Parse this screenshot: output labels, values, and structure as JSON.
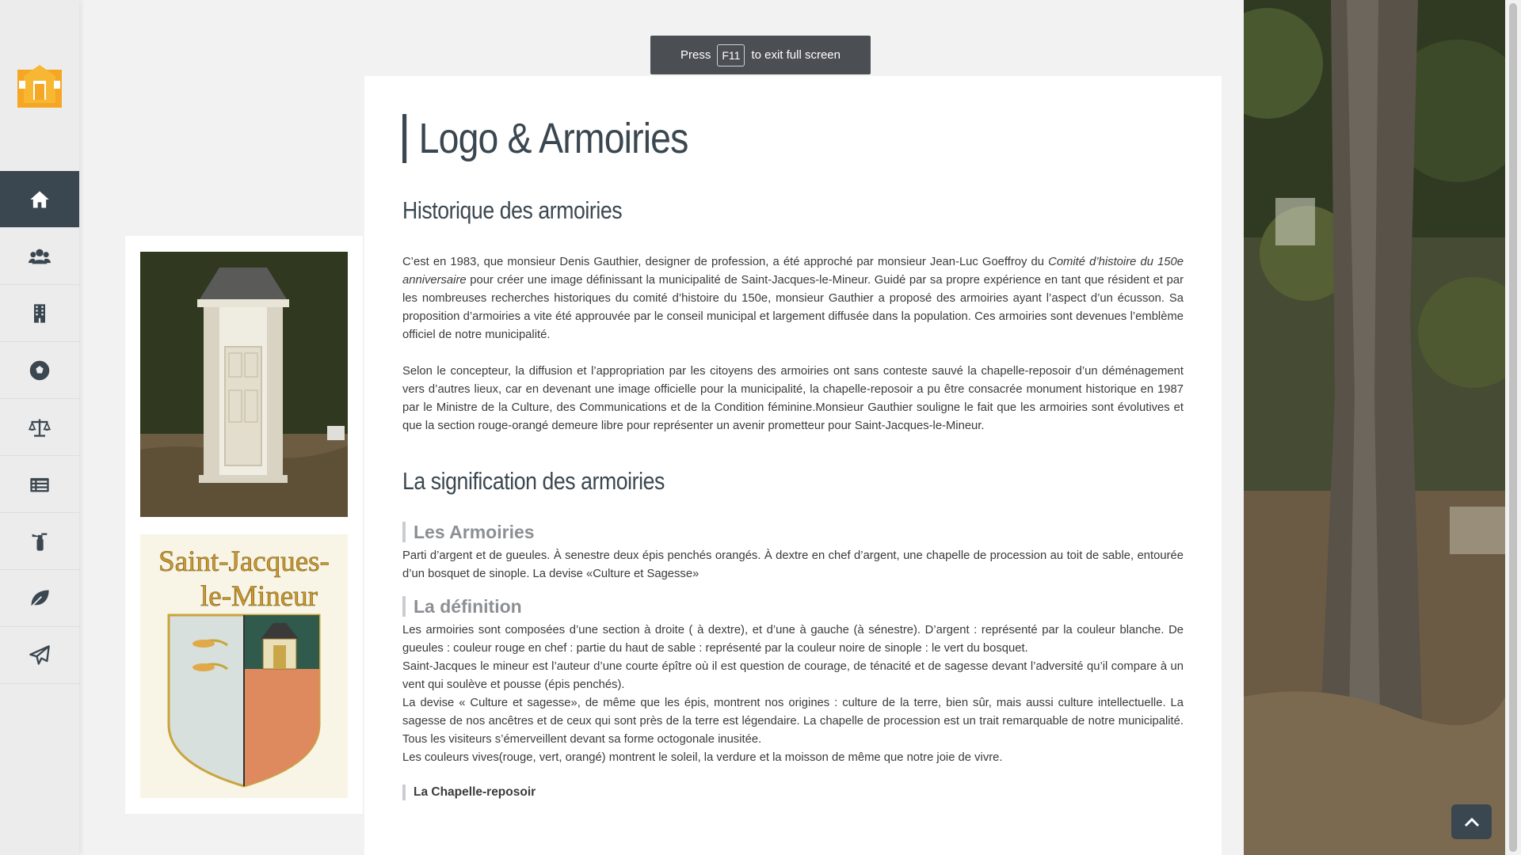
{
  "toast": {
    "press": "Press",
    "key": "F11",
    "rest": "to exit full screen"
  },
  "nav": {
    "logo_icon": "municipal-house-logo",
    "items": [
      {
        "icon": "home-icon",
        "active": true
      },
      {
        "icon": "users-icon",
        "active": false
      },
      {
        "icon": "building-icon",
        "active": false
      },
      {
        "icon": "soccer-ball-icon",
        "active": false
      },
      {
        "icon": "balance-scale-icon",
        "active": false
      },
      {
        "icon": "list-icon",
        "active": false
      },
      {
        "icon": "fire-extinguisher-icon",
        "active": false
      },
      {
        "icon": "leaf-icon",
        "active": false
      },
      {
        "icon": "paper-plane-icon",
        "active": false
      }
    ],
    "active_color": "#3b4750"
  },
  "sidebar": {
    "crest_line1": "Saint-Jacques-",
    "crest_line2": "le-Mineur"
  },
  "main": {
    "title": "Logo & Armoiries",
    "section1": {
      "heading": "Historique des armoiries",
      "p1_a": "C’est en 1983, que monsieur Denis Gauthier, designer de profession, a été approché par monsieur Jean-Luc Goeffroy du ",
      "p1_em": "Comité d’histoire du 150e anniversaire",
      "p1_b": " pour créer une image définissant la municipalité de Saint-Jacques-le-Mineur. Guidé par sa propre expérience en tant que résident et par les nombreuses recherches historiques du comité d’histoire du 150e, monsieur Gauthier a proposé des armoiries ayant l’aspect d’un écusson. Sa proposition d’armoiries a vite été approuvée par le conseil municipal et largement diffusée dans la population. Ces armoiries sont devenues l’emblème officiel de notre municipalité.",
      "p2": "Selon le concepteur, la diffusion et l’appropriation par les citoyens des armoiries ont sans conteste sauvé la chapelle-reposoir d’un déménagement vers d’autres lieux, car en devenant une image officielle pour la municipalité, la chapelle-reposoir a pu être consacrée monument historique en 1987 par le Ministre de la Culture, des Communications et de la Condition féminine.Monsieur Gauthier souligne le fait que les armoiries sont évolutives et que la section rouge-orangé demeure libre pour représenter un avenir prometteur pour Saint-Jacques-le-Mineur."
    },
    "section2": {
      "heading": "La signification des armoiries",
      "sub1": "Les Armoiries",
      "sub1_text": "Parti d’argent et de gueules. À senestre deux épis penchés orangés. À dextre en chef d’argent, une chapelle de procession au toit de sable, entourée d’un bosquet de sinople. La devise «Culture et Sagesse»",
      "sub2": "La définition",
      "sub2_l1": "Les armoiries sont composées d’une section à droite ( à dextre), et d’une à gauche (à sénestre). D’argent : représenté par la couleur blanche. De gueules : couleur rouge en chef : partie du haut de sable : représenté par la couleur noire de sinople : le vert du bosquet.",
      "sub2_l2": "Saint-Jacques le mineur est l’auteur d’une courte épître où il est question de courage, de ténacité et de sagesse devant l’adversité qu’il compare à un vent qui soulève et pousse (épis penchés).",
      "sub2_l3": "La devise « Culture et sagesse», de même que les épis, montrent nos origines : culture de la terre, bien sûr, mais aussi culture intellectuelle. La sagesse de nos ancêtres et de ceux qui sont près de la terre est légendaire. La chapelle de procession est un trait remarquable de notre municipalité. Tous les visiteurs s’émerveillent devant sa forme octogonale inusitée.",
      "sub2_l4": "Les couleurs vives(rouge, vert, orangé) montrent le soleil, la verdure et la moisson de même que notre joie de vivre.",
      "sub3": "La Chapelle-reposoir"
    }
  },
  "scroll_top_icon": "chevron-up-icon"
}
